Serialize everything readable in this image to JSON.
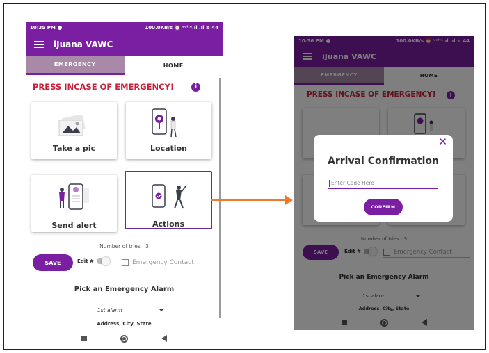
{
  "phone1": {
    "status": {
      "time": "10:35 PM",
      "right": "100.0KB/s ⏰ ᵛᵒˡᵗᵉ.ıl .ıl ≋ 44"
    },
    "app_title": "iJuana VAWC",
    "tabs": [
      {
        "label": "EMERGENCY"
      },
      {
        "label": "HOME"
      }
    ],
    "banner": "PRESS INCASE OF EMERGENCY!",
    "info_icon": "i",
    "cards": [
      {
        "label": "Take a pic",
        "icon": "photo-icon"
      },
      {
        "label": "Location",
        "icon": "map-pin-icon"
      },
      {
        "label": "Send alert",
        "icon": "alert-phone-icon"
      },
      {
        "label": "Actions",
        "icon": "actions-phone-icon"
      }
    ],
    "tries": "Number of tries : 3",
    "save_label": "SAVE",
    "edit_label": "Edit #",
    "emergency_contact_placeholder": "Emergency Contact",
    "pick_label": "Pick an Emergency Alarm",
    "alarm_selected": "1st alarm",
    "address_label": "Address, City, State"
  },
  "phone2": {
    "status": {
      "time": "10:36 PM",
      "right": "100.0KB/s ⏰ ᵛᵒˡᵗᵉ.ıl .ıl ≋ 44"
    },
    "app_title": "iJuana VAWC",
    "tabs": [
      {
        "label": "EMERGENCY"
      },
      {
        "label": "HOME"
      }
    ],
    "banner": "PRESS INCASE OF EMERGENCY!",
    "tries": "Number of tries : 3",
    "save_label": "SAVE",
    "edit_label": "Edit #",
    "emergency_contact_placeholder": "Emergency Contact",
    "pick_label": "Pick an Emergency Alarm",
    "alarm_selected": "1st alarm",
    "address_label": "Address, City, State",
    "dialog": {
      "title": "Arrival Confirmation",
      "close_icon": "✕",
      "input_placeholder": "Enter Code Here",
      "confirm_label": "CONFIRM"
    }
  },
  "colors": {
    "primary": "#7a1fa2",
    "banner_red": "#c8203a",
    "arrow": "#ee7a2c",
    "highlight_box": "#6a2c91"
  }
}
